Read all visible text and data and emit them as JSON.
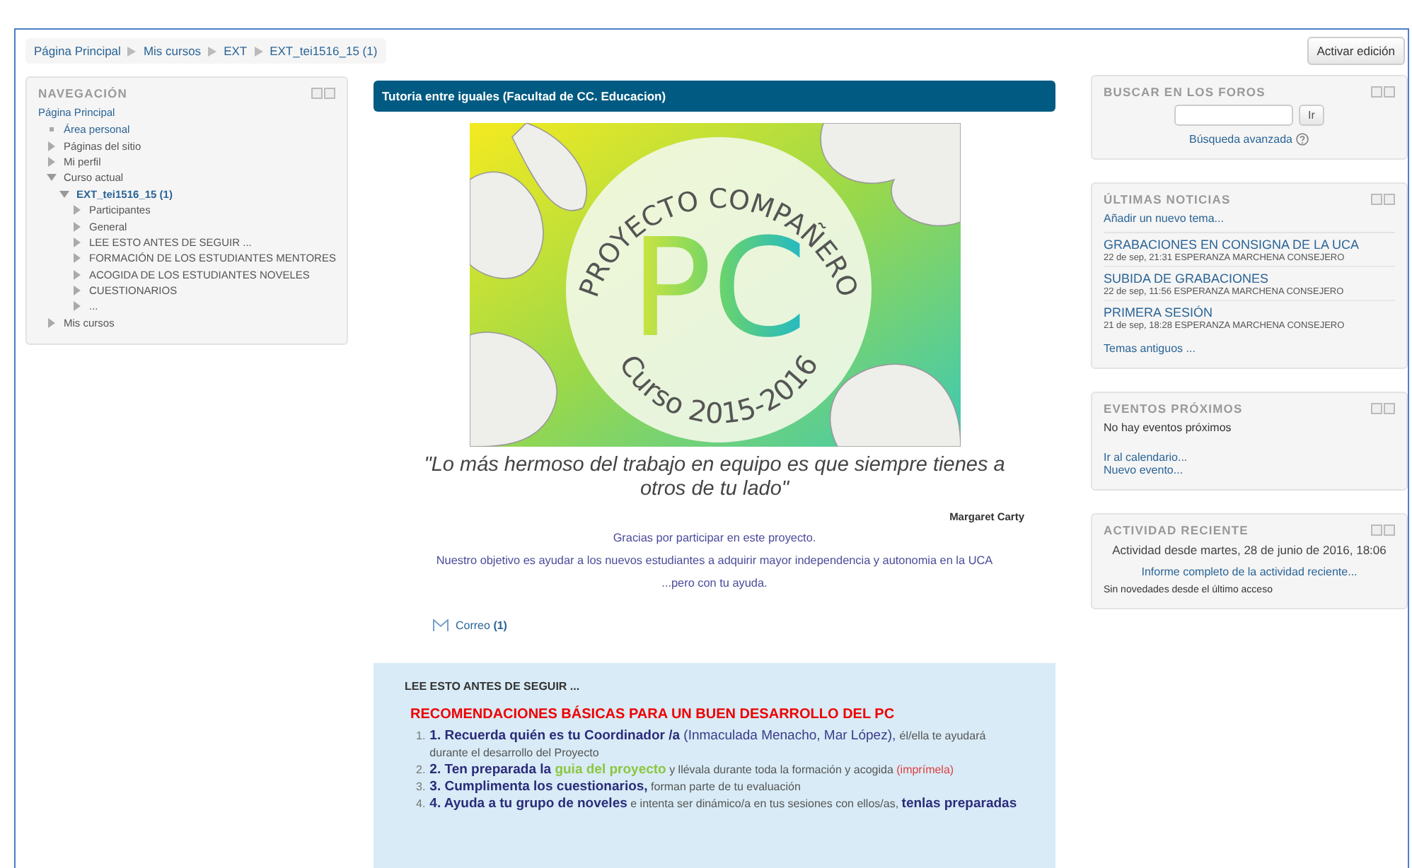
{
  "breadcrumb": [
    "Página Principal",
    "Mis cursos",
    "EXT",
    "EXT_tei1516_15 (1)"
  ],
  "edit_button": "Activar edición",
  "navigation": {
    "title": "NAVEGACIÓN",
    "home": "Página Principal",
    "items": [
      {
        "label": "Área personal",
        "kind": "leaf"
      },
      {
        "label": "Páginas del sitio",
        "kind": "branch",
        "expanded": false
      },
      {
        "label": "Mi perfil",
        "kind": "branch",
        "expanded": false
      },
      {
        "label": "Curso actual",
        "kind": "branch",
        "expanded": true,
        "children": [
          {
            "label": "EXT_tei1516_15 (1)",
            "kind": "course",
            "expanded": true,
            "children": [
              {
                "label": "Participantes",
                "kind": "branch",
                "expanded": false
              },
              {
                "label": "General",
                "kind": "branch",
                "expanded": false
              },
              {
                "label": "LEE ESTO ANTES DE SEGUIR ...",
                "kind": "branch",
                "expanded": false
              },
              {
                "label": "FORMACIÓN DE LOS ESTUDIANTES MENTORES",
                "kind": "branch",
                "expanded": false
              },
              {
                "label": "ACOGIDA DE LOS ESTUDIANTES NOVELES",
                "kind": "branch",
                "expanded": false
              },
              {
                "label": "CUESTIONARIOS",
                "kind": "branch",
                "expanded": false
              },
              {
                "label": "...",
                "kind": "branch",
                "expanded": false
              }
            ]
          }
        ]
      },
      {
        "label": "Mis cursos",
        "kind": "branch",
        "expanded": false
      }
    ]
  },
  "main": {
    "title": "Tutoria entre iguales (Facultad de CC. Educacion)",
    "banner": {
      "arc_title": "PROYECTO COMPAÑERO",
      "monogram": "PC",
      "course": "Curso 2015-2016"
    },
    "quote": "\"Lo más hermoso del trabajo en equipo es que siempre tienes a otros de tu lado\"",
    "author": "Margaret Carty",
    "paragraphs": [
      "Gracias por participar en este proyecto.",
      "Nuestro objetivo es ayudar a los nuevos estudiantes a adquirir mayor independencia y autonomia en la UCA",
      "...pero con tu ayuda."
    ],
    "mail": {
      "label": "Correo",
      "count": "(1)"
    }
  },
  "section": {
    "title": "LEE ESTO ANTES DE SEGUIR ...",
    "heading": "RECOMENDACIONES BÁSICAS PARA UN BUEN DESARROLLO DEL PC",
    "items": [
      {
        "number": "1.",
        "parts": [
          {
            "kind": "strong",
            "text": "1. Recuerda quién es tu Coordinador /a"
          },
          {
            "kind": "plain",
            "text": " (Inmaculada Menacho, Mar López), "
          },
          {
            "kind": "small",
            "text": "él/ella te ayudará durante el desarrollo del Proyecto"
          }
        ]
      },
      {
        "number": "2.",
        "parts": [
          {
            "kind": "strong",
            "text": "2. Ten preparada la "
          },
          {
            "kind": "highlight",
            "text": "guia del proyecto"
          },
          {
            "kind": "small",
            "text": " y llévala durante toda la formación y acogida "
          },
          {
            "kind": "warning",
            "text": "(imprímela)"
          }
        ]
      },
      {
        "number": "3.",
        "parts": [
          {
            "kind": "strong",
            "text": "3. Cumplimenta los cuestionarios,"
          },
          {
            "kind": "small",
            "text": " forman parte de tu evaluación"
          }
        ]
      },
      {
        "number": "4.",
        "parts": [
          {
            "kind": "strong",
            "text": "4. Ayuda a tu grupo de noveles"
          },
          {
            "kind": "small",
            "text": " e intenta ser dinámico/a en tus sesiones con ellos/as, "
          },
          {
            "kind": "strong",
            "text": "tenlas preparadas"
          }
        ]
      }
    ]
  },
  "search": {
    "title": "BUSCAR EN LOS FOROS",
    "button": "Ir",
    "advanced": "Búsqueda avanzada"
  },
  "news": {
    "title": "ÚLTIMAS NOTICIAS",
    "add": "Añadir un nuevo tema...",
    "items": [
      {
        "title": "GRABACIONES EN CONSIGNA DE LA UCA",
        "date": "22 de sep, 21:31",
        "author": "ESPERANZA MARCHENA CONSEJERO"
      },
      {
        "title": "SUBIDA DE GRABACIONES",
        "date": "22 de sep, 11:56",
        "author": "ESPERANZA MARCHENA CONSEJERO"
      },
      {
        "title": "PRIMERA SESIÓN",
        "date": "21 de sep, 18:28",
        "author": "ESPERANZA MARCHENA CONSEJERO"
      }
    ],
    "older": "Temas antiguos ..."
  },
  "events": {
    "title": "EVENTOS PRÓXIMOS",
    "empty": "No hay eventos próximos",
    "links": [
      "Ir al calendario...",
      "Nuevo evento..."
    ]
  },
  "activity": {
    "title": "ACTIVIDAD RECIENTE",
    "since": "Actividad desde martes, 28 de junio de 2016, 18:06",
    "report": "Informe completo de la actividad reciente...",
    "none": "Sin novedades desde el último acceso"
  }
}
